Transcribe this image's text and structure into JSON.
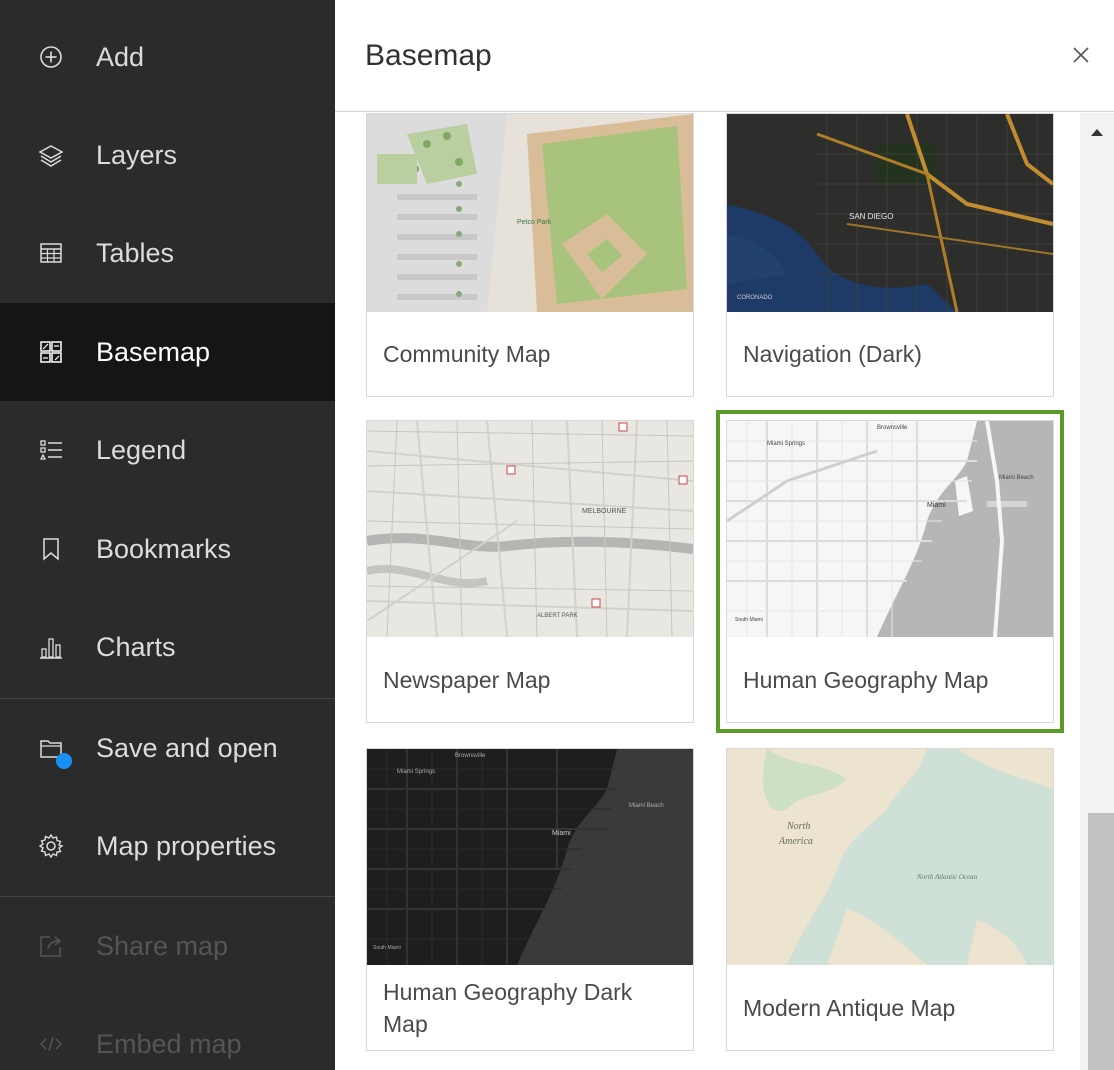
{
  "sidebar": {
    "items": [
      {
        "label": "Add",
        "icon": "add-circle-icon"
      },
      {
        "label": "Layers",
        "icon": "layers-icon"
      },
      {
        "label": "Tables",
        "icon": "table-icon"
      },
      {
        "label": "Basemap",
        "icon": "basemap-icon",
        "active": true
      },
      {
        "label": "Legend",
        "icon": "legend-icon"
      },
      {
        "label": "Bookmarks",
        "icon": "bookmark-icon"
      },
      {
        "label": "Charts",
        "icon": "chart-icon"
      },
      {
        "label": "Save and open",
        "icon": "folder-icon"
      },
      {
        "label": "Map properties",
        "icon": "gear-icon"
      },
      {
        "label": "Share map",
        "icon": "share-icon",
        "disabled": true
      },
      {
        "label": "Embed map",
        "icon": "code-icon",
        "disabled": true
      }
    ]
  },
  "panel": {
    "title": "Basemap",
    "close_icon": "close-icon"
  },
  "basemaps": [
    {
      "label": "Community Map"
    },
    {
      "label": "Navigation (Dark)"
    },
    {
      "label": "Newspaper Map"
    },
    {
      "label": "Human Geography Map",
      "selected": true
    },
    {
      "label": "Human Geography Dark Map"
    },
    {
      "label": "Modern Antique Map"
    }
  ],
  "thumb_text": {
    "community": "Petco Park",
    "nav_dark_1": "SAN DIEGO",
    "nav_dark_2": "CORONADO",
    "newspaper_1": "MELBOURNE",
    "newspaper_2": "ALBERT PARK",
    "human_1": "Brownsville",
    "human_2": "Miami Springs",
    "human_3": "Miami Beach",
    "human_4": "Miami",
    "human_5": "South Miami",
    "antique_1": "North",
    "antique_2": "America",
    "antique_3": "North Atlantic Ocean"
  },
  "colors": {
    "sidebar_bg": "#2b2b2b",
    "active_bg": "#151515",
    "selected_outline": "#5a9c28",
    "notify_dot": "#1a8ff5"
  }
}
